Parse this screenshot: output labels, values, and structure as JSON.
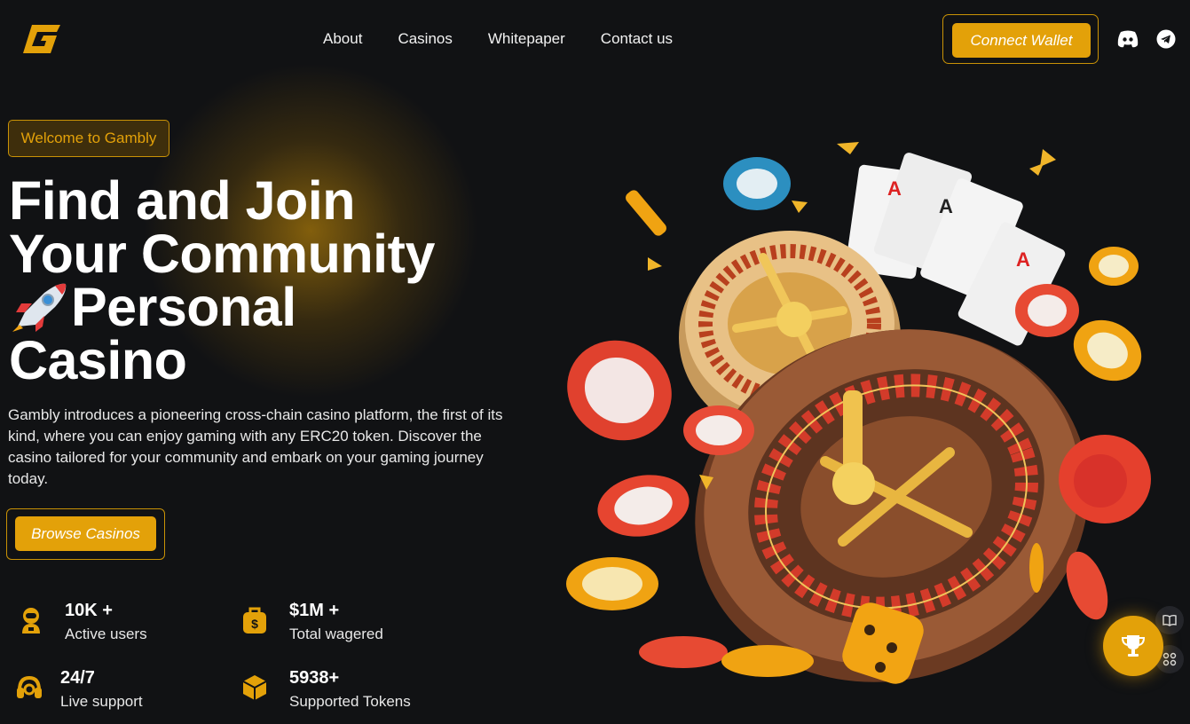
{
  "brand": {
    "accent": "#e3a109",
    "background": "#111214",
    "logo": "g-logo-icon"
  },
  "nav": {
    "items": [
      {
        "label": "About"
      },
      {
        "label": "Casinos"
      },
      {
        "label": "Whitepaper"
      },
      {
        "label": "Contact us"
      }
    ]
  },
  "header": {
    "connect_wallet": "Connect Wallet",
    "icons": [
      "discord-icon",
      "telegram-icon"
    ]
  },
  "hero": {
    "badge": "Welcome to Gambly",
    "headline_line1": "Find and Join",
    "headline_line2": "Your Community",
    "headline_line3": "Personal",
    "headline_line4": "Casino",
    "rocket_icon": "rocket-icon",
    "description": "Gambly introduces a pioneering cross-chain casino platform, the first of its kind, where you can enjoy gaming with any ERC20 token. Discover the casino tailored for your community and embark on your gaming journey today.",
    "cta": "Browse Casinos",
    "illustration": "roulette-casino-illustration"
  },
  "stats": [
    {
      "value": "10K +",
      "label": "Active users",
      "icon": "astronaut-icon"
    },
    {
      "value": "$1M +",
      "label": "Total wagered",
      "icon": "money-bag-icon"
    },
    {
      "value": "24/7",
      "label": "Live support",
      "icon": "headset-icon"
    },
    {
      "value": "5938+",
      "label": "Supported Tokens",
      "icon": "token-cube-icon"
    }
  ],
  "floating": {
    "icons": [
      "book-icon",
      "apps-grid-icon",
      "trophy-icon"
    ]
  }
}
